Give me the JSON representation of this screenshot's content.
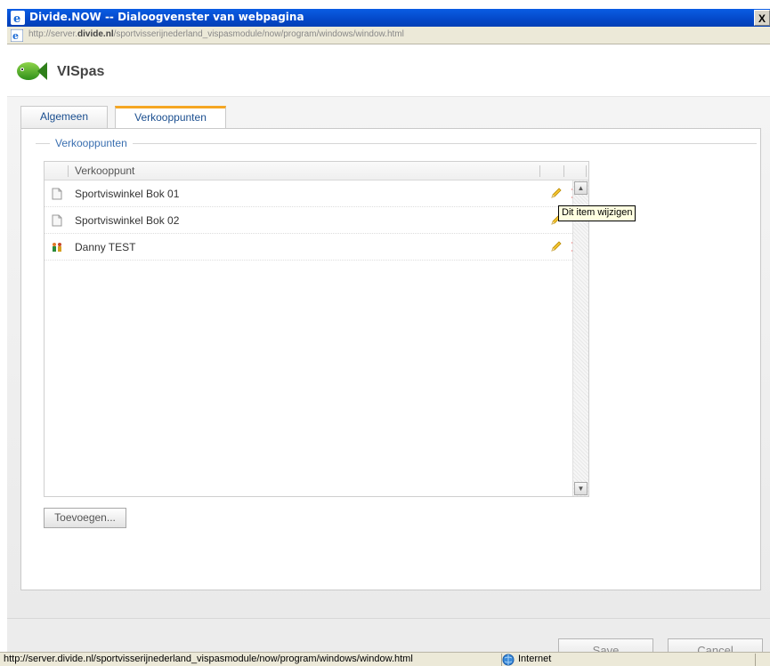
{
  "window": {
    "title": "Divide.NOW -- Dialoogvenster van webpagina",
    "close_label": "X",
    "url_prefix": "http://server.",
    "url_domain": "divide.nl",
    "url_path": "/sportvisserijnederland_vispasmodule/now/program/windows/window.html"
  },
  "app": {
    "name": "VISpas"
  },
  "tabs": [
    {
      "label": "Algemeen",
      "active": false
    },
    {
      "label": "Verkooppunten",
      "active": true
    }
  ],
  "section": {
    "title": "Verkooppunten"
  },
  "grid": {
    "column_header": "Verkooppunt",
    "rows": [
      {
        "label": "Sportviswinkel Bok 01",
        "icon": "document-icon"
      },
      {
        "label": "Sportviswinkel Bok 02",
        "icon": "document-icon"
      },
      {
        "label": "Danny TEST",
        "icon": "people-icon"
      }
    ],
    "scroll_up": "▲",
    "scroll_down": "▼"
  },
  "tooltip": {
    "text": "Dit item wijzigen"
  },
  "actions": {
    "add_label": "Toevoegen...",
    "save_label": "Save",
    "cancel_label": "Cancel"
  },
  "statusbar": {
    "url": "http://server.divide.nl/sportvisserijnederland_vispasmodule/now/program/windows/window.html",
    "zone": "Internet"
  },
  "colors": {
    "titlebar": "#0448c8",
    "tab_active_accent": "#f5a623",
    "link_blue": "#3a6fb0",
    "delete_red": "#e01818"
  }
}
